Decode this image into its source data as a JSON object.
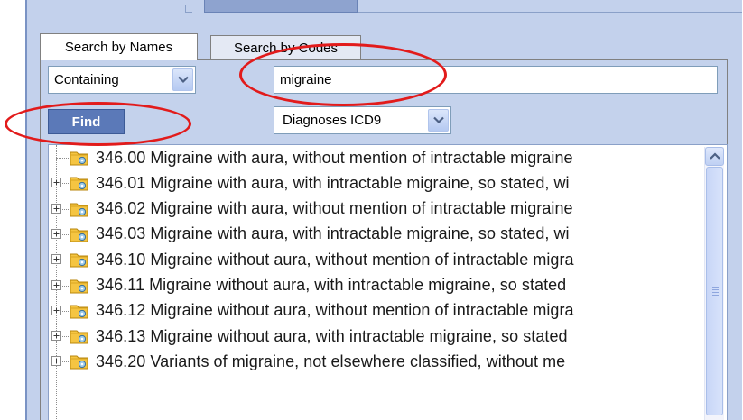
{
  "tabs": [
    {
      "label": "Search by Names",
      "active": true
    },
    {
      "label": "Search by Codes",
      "active": false
    }
  ],
  "search": {
    "match_mode": "Containing",
    "query": "migraine",
    "find_label": "Find",
    "code_system": "Diagnoses ICD9"
  },
  "results": [
    {
      "label": "346.00 Migraine with aura, without mention of intractable migraine",
      "expandable": false
    },
    {
      "label": "346.01 Migraine with aura, with intractable migraine, so stated, wi",
      "expandable": true
    },
    {
      "label": "346.02 Migraine with aura, without mention of intractable migraine",
      "expandable": true
    },
    {
      "label": "346.03 Migraine with aura, with intractable migraine, so stated, wi",
      "expandable": true
    },
    {
      "label": "346.10 Migraine without aura, without mention of intractable migra",
      "expandable": true
    },
    {
      "label": "346.11 Migraine without aura, with intractable migraine, so stated",
      "expandable": true
    },
    {
      "label": "346.12 Migraine without aura, without mention of intractable migra",
      "expandable": true
    },
    {
      "label": "346.13 Migraine without aura, with intractable migraine, so stated",
      "expandable": true
    },
    {
      "label": "346.20 Variants of migraine, not elsewhere classified, without me",
      "expandable": true
    }
  ],
  "colors": {
    "panel": "#c4d2ec",
    "find_button": "#5b79b8",
    "annotation": "#e21b1b",
    "folder": "#f5c542"
  },
  "icons": {
    "folder": "folder-icon",
    "expand": "plus-icon",
    "dropdown": "chevron-down-icon",
    "scroll_up": "scroll-up-icon"
  }
}
